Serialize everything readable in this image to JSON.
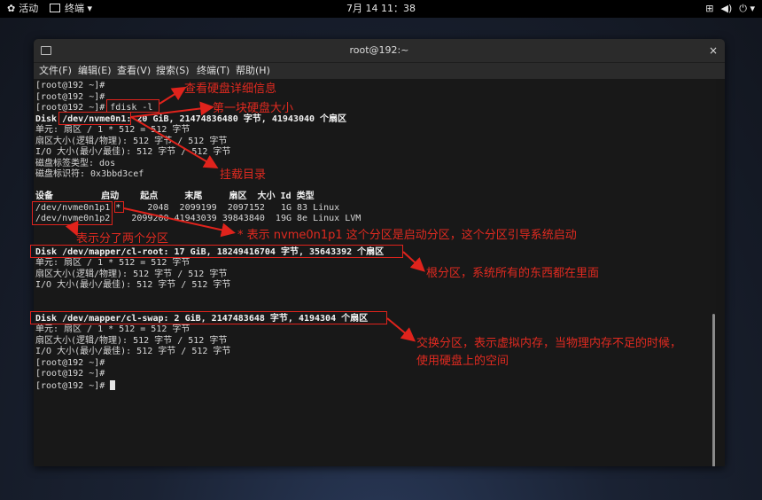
{
  "topbar": {
    "activities": "活动",
    "terminal_menu": "终端",
    "clock": "7月 14 11：38",
    "tray_icons": [
      "network-icon",
      "volume-icon",
      "power-icon"
    ]
  },
  "window": {
    "title": "root@192:~",
    "close_glyph": "×",
    "menus": [
      "文件(F)",
      "编辑(E)",
      "查看(V)",
      "搜索(S)",
      "终端(T)",
      "帮助(H)"
    ]
  },
  "terminal": {
    "lines": [
      "[root@192 ~]#",
      "[root@192 ~]#",
      "[root@192 ~]# fdisk -l",
      "Disk /dev/nvme0n1: 20 GiB, 21474836480 字节, 41943040 个扇区",
      "单元: 扇区 / 1 * 512 = 512 字节",
      "扇区大小(逻辑/物理): 512 字节 / 512 字节",
      "I/O 大小(最小/最佳): 512 字节 / 512 字节",
      "磁盘标签类型: dos",
      "磁盘标识符: 0x3bbd3cef",
      "",
      "设备         启动    起点     末尾     扇区  大小 Id 类型",
      "/dev/nvme0n1p1 *     2048  2099199  2097152   1G 83 Linux",
      "/dev/nvme0n1p2    2099200 41943039 39843840  19G 8e Linux LVM",
      "",
      "",
      "Disk /dev/mapper/cl-root: 17 GiB, 18249416704 字节, 35643392 个扇区",
      "单元: 扇区 / 1 * 512 = 512 字节",
      "扇区大小(逻辑/物理): 512 字节 / 512 字节",
      "I/O 大小(最小/最佳): 512 字节 / 512 字节",
      "",
      "",
      "Disk /dev/mapper/cl-swap: 2 GiB, 2147483648 字节, 4194304 个扇区",
      "单元: 扇区 / 1 * 512 = 512 字节",
      "扇区大小(逻辑/物理): 512 字节 / 512 字节",
      "I/O 大小(最小/最佳): 512 字节 / 512 字节",
      "[root@192 ~]#",
      "[root@192 ~]#",
      "[root@192 ~]#"
    ]
  },
  "annotations": {
    "fdisk": "查看硬盘详细信息",
    "first_disk": "第一块硬盘大小",
    "mount": "挂载目录",
    "two_partitions": "表示分了两个分区",
    "boot_flag": "* 表示 nvme0n1p1 这个分区是启动分区，这个分区引导系统启动",
    "root": "根分区，系统所有的东西都在里面",
    "swap_line1": "交换分区，表示虚拟内存，当物理内存不足的时候，",
    "swap_line2": "使用硬盘上的空间"
  },
  "colors": {
    "annotation": "#e0231c",
    "terminal_bg": "#181818",
    "titlebar_bg": "#2b2b2b"
  }
}
